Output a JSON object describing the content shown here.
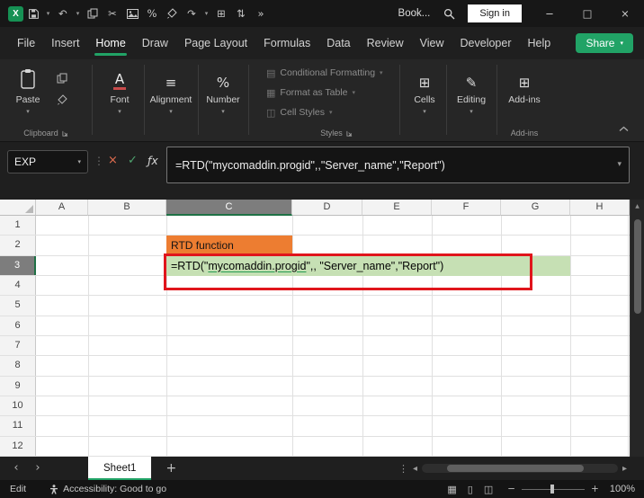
{
  "app": {
    "logo_letter": "X",
    "workbook_name": "Book...",
    "sign_in": "Sign in"
  },
  "menu": {
    "items": [
      "File",
      "Insert",
      "Home",
      "Draw",
      "Page Layout",
      "Formulas",
      "Data",
      "Review",
      "View",
      "Developer",
      "Help"
    ],
    "active_item": "Home",
    "share": "Share"
  },
  "ribbon": {
    "paste": "Paste",
    "clipboard_group": "Clipboard",
    "font": "Font",
    "alignment": "Alignment",
    "number": "Number",
    "styles_items": [
      "Conditional Formatting",
      "Format as Table",
      "Cell Styles"
    ],
    "styles_group": "Styles",
    "cells": "Cells",
    "editing": "Editing",
    "addins": "Add-ins",
    "addins_group": "Add-ins"
  },
  "formula_bar": {
    "name_box": "EXP",
    "formula": "=RTD(\"mycomaddin.progid\",,\"Server_name\",\"Report\")"
  },
  "grid": {
    "columns": [
      "A",
      "B",
      "C",
      "D",
      "E",
      "F",
      "G",
      "H"
    ],
    "rows": [
      "1",
      "2",
      "3",
      "4",
      "5",
      "6",
      "7",
      "8",
      "9",
      "10",
      "11",
      "12"
    ],
    "selected_column": "C",
    "selected_row": "3",
    "c2_text": "RTD function",
    "c3_prefix": "=RTD(\"",
    "c3_progid": "mycomaddin.progid",
    "c3_suffix": "\",, \"Server_name\",\"Report\")"
  },
  "sheet_bar": {
    "tab": "Sheet1"
  },
  "status_bar": {
    "mode": "Edit",
    "accessibility": "Accessibility: Good to go",
    "zoom": "100%"
  },
  "icons": {
    "dropdown": "▾",
    "undo": "↶",
    "redo": "↷",
    "cut": "✂",
    "percent": "%",
    "sort": "⇅",
    "table": "⊞",
    "overflow": "»",
    "ellipsis_v": "⋮",
    "cancel": "×",
    "enter": "✓",
    "fx": "ƒx",
    "minimize": "−",
    "maximize": "□",
    "close": "×",
    "tab_prev": "‹",
    "tab_next": "›",
    "scroll_left": "◂",
    "scroll_right": "▸",
    "scroll_up": "▲",
    "font_a": "A",
    "align": "≡",
    "cells": "⊞",
    "editing": "✎",
    "addins": "⊞",
    "plus": "+",
    "cf_icon": "▤",
    "table_icon": "▦",
    "styles_icon": "◫",
    "view_normal": "▦",
    "view_layout": "▯",
    "view_break": "◫",
    "zoom_out": "−",
    "zoom_in": "+"
  },
  "colors": {
    "accent_green": "#21a366",
    "c2_fill": "#ed7d31",
    "c3_fill": "#c6e0b4",
    "annotation_red": "#e0151c",
    "selected_header": "#7d7d7d"
  }
}
